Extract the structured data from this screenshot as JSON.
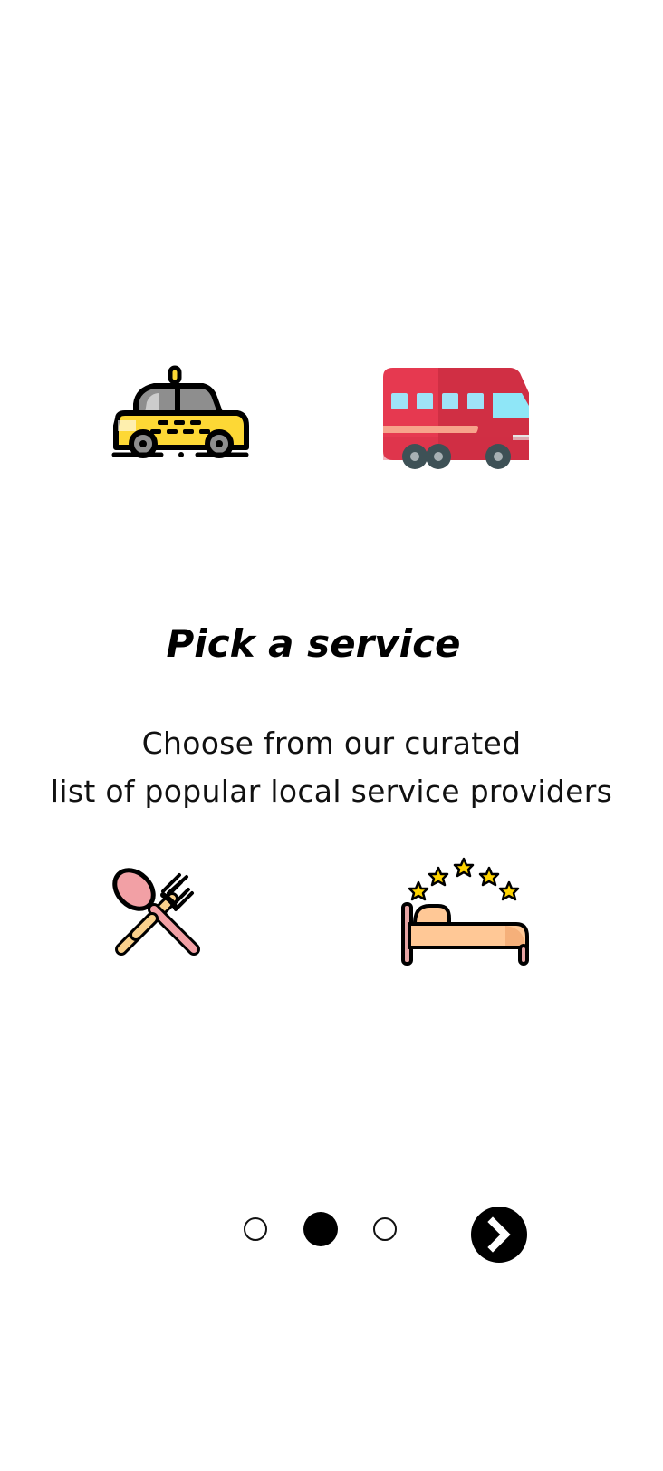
{
  "onboarding": {
    "title": "Pick a service",
    "subtitle_lines": [
      "Choose from our curated",
      "list of popular local service providers"
    ],
    "icons": [
      "taxi-icon",
      "bus-icon",
      "fork-spoon-icon",
      "hotel-bed-icon"
    ]
  },
  "pager": {
    "total_pages": 3,
    "current_page": 2,
    "next_icon": "chevron-right-icon"
  },
  "colors": {
    "background": "#ffffff",
    "text": "#000000",
    "taxi_yellow": "#FDD835",
    "bus_red": "#E63950",
    "spoon_pink": "#F2A0A5",
    "fork_beige": "#F9D08C",
    "bed_peach": "#FFC896",
    "star_yellow": "#FFD400"
  }
}
